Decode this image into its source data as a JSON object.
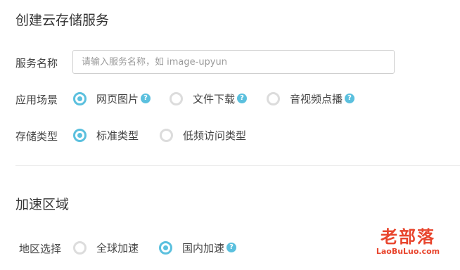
{
  "create_section": {
    "title": "创建云存储服务",
    "service_name": {
      "label": "服务名称",
      "value": "",
      "placeholder": "请输入服务名称，如 image-upyun"
    },
    "scenario": {
      "label": "应用场景",
      "options": [
        {
          "label": "网页图片",
          "checked": true,
          "help": "?"
        },
        {
          "label": "文件下载",
          "checked": false,
          "help": "?"
        },
        {
          "label": "音视频点播",
          "checked": false,
          "help": "?"
        }
      ]
    },
    "storage_type": {
      "label": "存储类型",
      "options": [
        {
          "label": "标准类型",
          "checked": true
        },
        {
          "label": "低频访问类型",
          "checked": false
        }
      ]
    }
  },
  "accel_section": {
    "title": "加速区域",
    "region": {
      "label": "地区选择",
      "options": [
        {
          "label": "全球加速",
          "checked": false
        },
        {
          "label": "国内加速",
          "checked": true,
          "help": "?"
        }
      ]
    }
  },
  "watermark": {
    "title": "老部落",
    "subtitle": "LaoBuLuo.com"
  },
  "colors": {
    "accent": "#5bc0de",
    "radio_unchecked_border": "#dcdcdc",
    "watermark": "#e8452d"
  }
}
